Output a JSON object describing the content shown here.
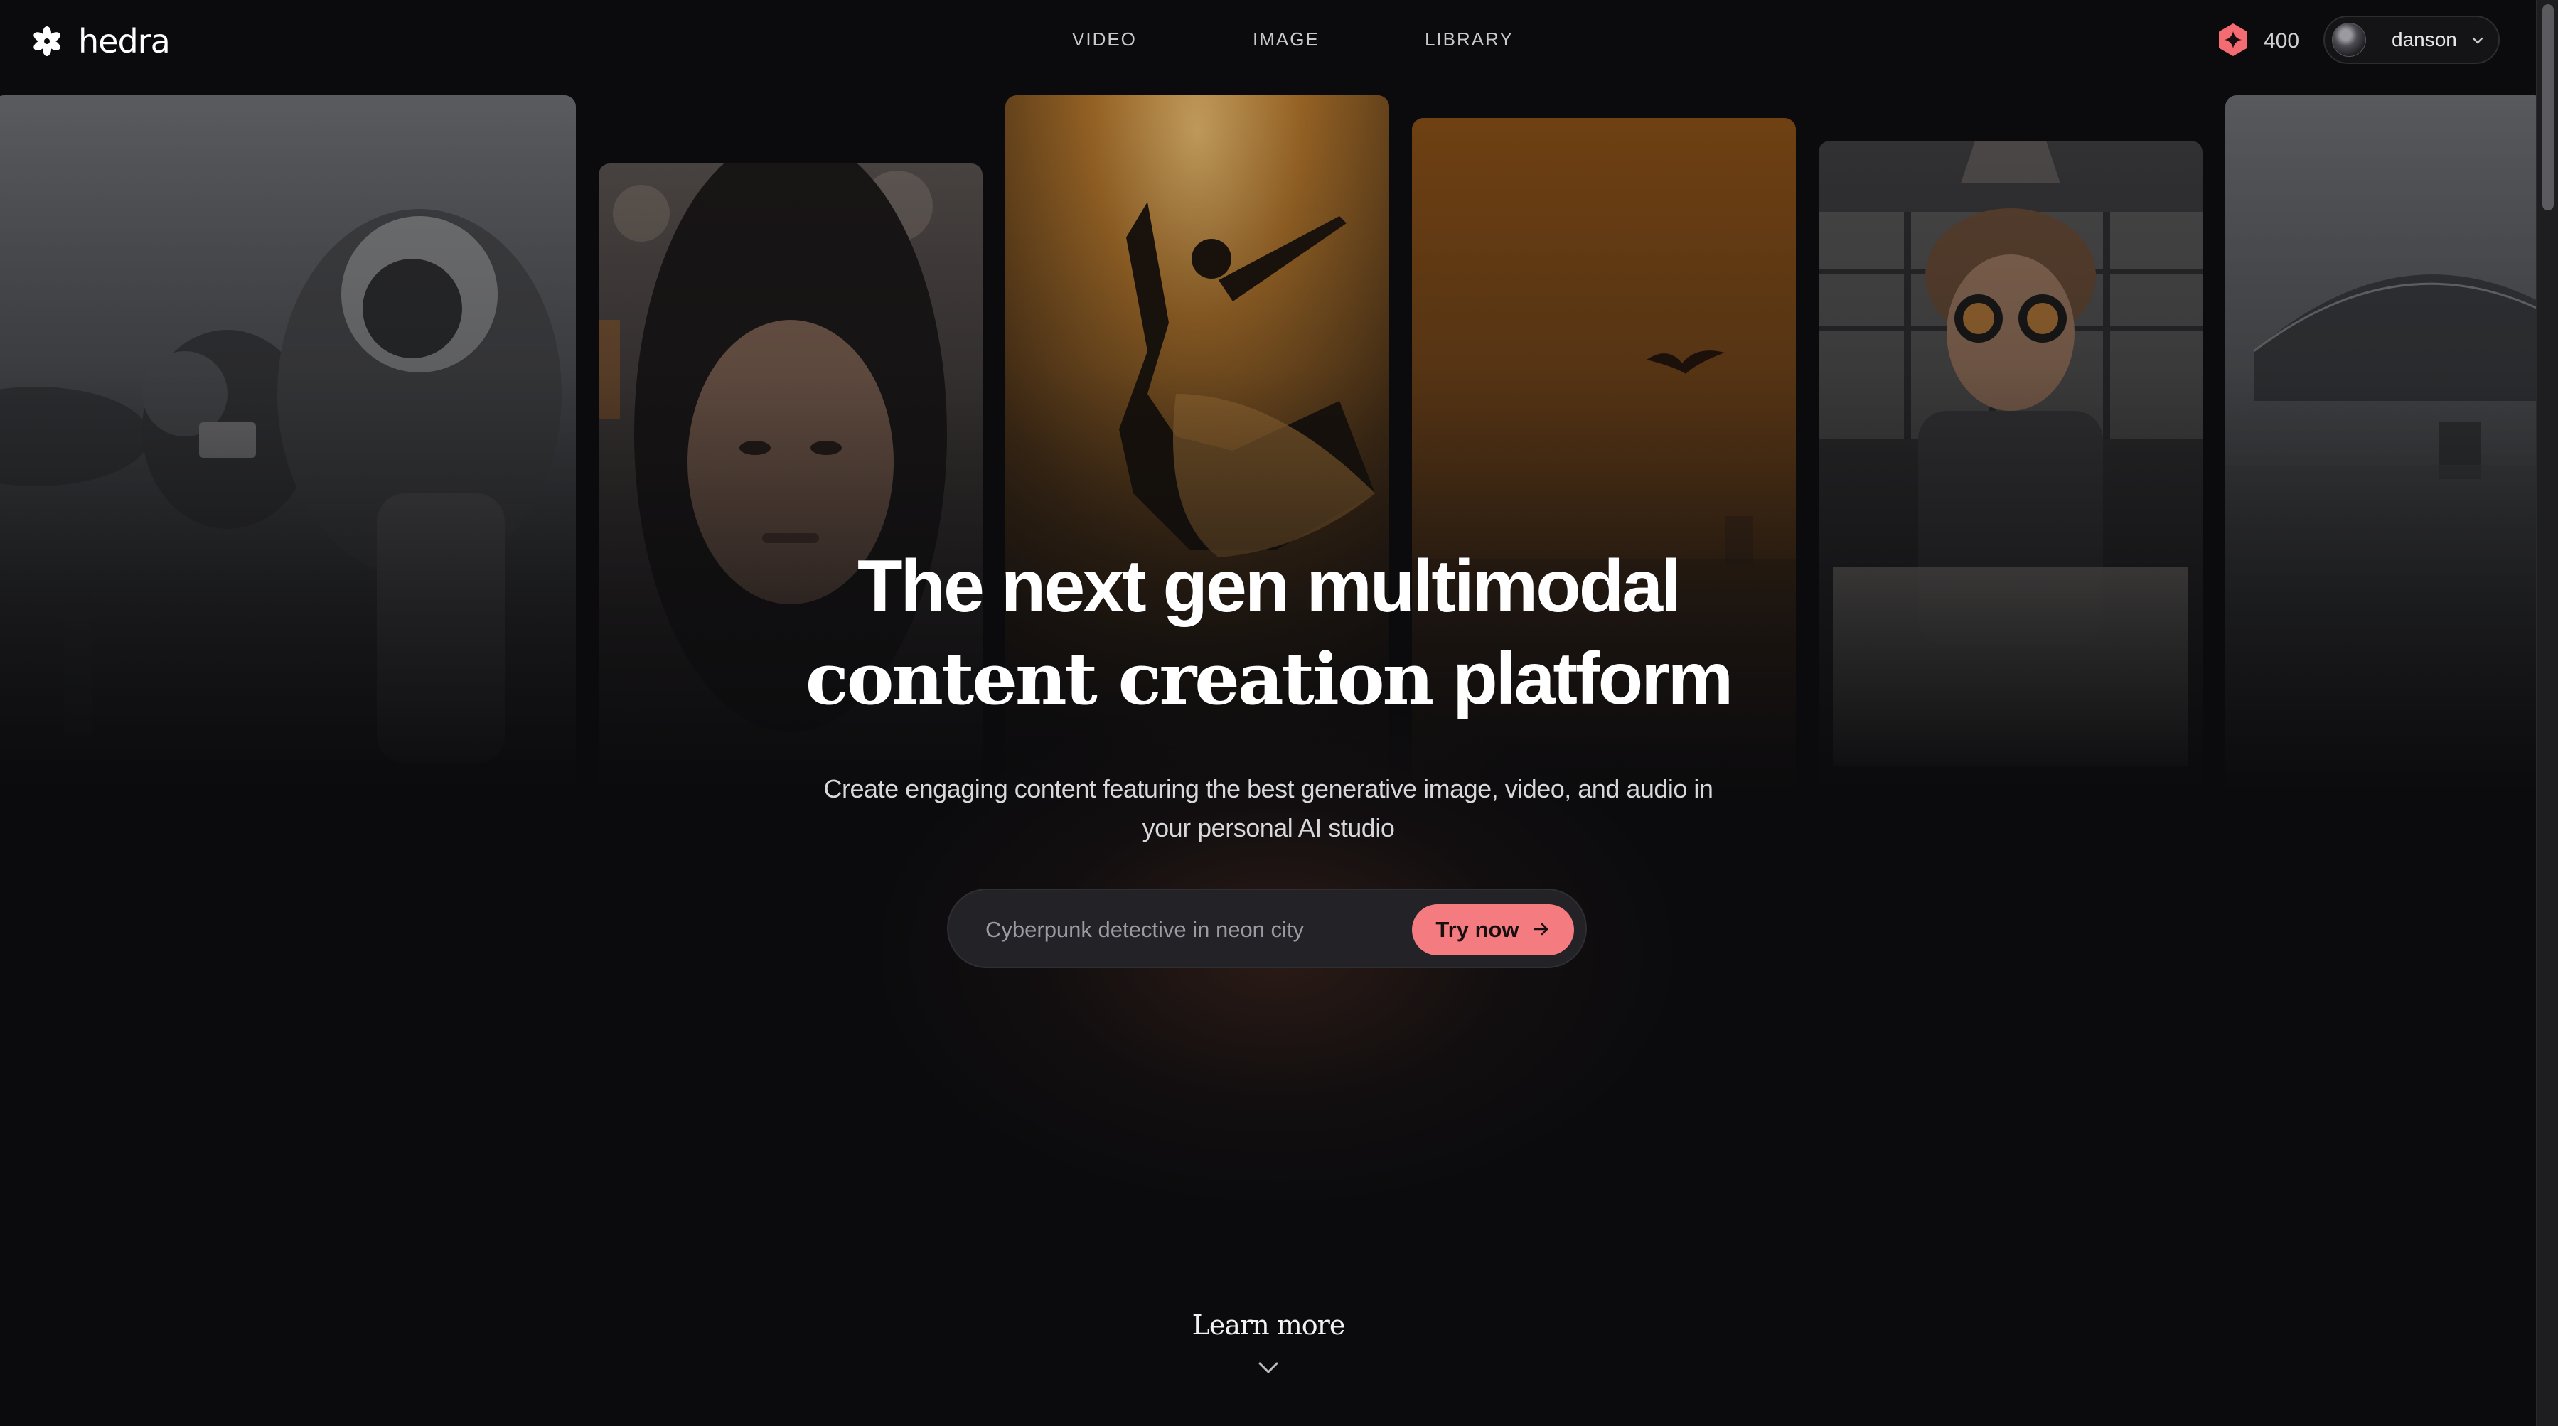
{
  "app": {
    "brand_name": "hedra",
    "logo_icon": "asterisk-flower-icon"
  },
  "nav": {
    "items": [
      {
        "label": "VIDEO"
      },
      {
        "label": "IMAGE"
      },
      {
        "label": "LIBRARY"
      }
    ]
  },
  "account": {
    "credits_icon": "credits-star-icon",
    "credits_count": "400",
    "credits_color": "#f46b72",
    "username": "danson"
  },
  "gallery": {
    "cards": [
      {
        "subject": "astronauts-on-snowy-planet"
      },
      {
        "subject": "woman-portrait"
      },
      {
        "subject": "ballet-dancer-sunset"
      },
      {
        "subject": "bird-over-orange-sky"
      },
      {
        "subject": "boy-with-goggles"
      },
      {
        "subject": "domed-station-snowscape"
      }
    ]
  },
  "hero": {
    "headline_line1": "The next gen multimodal",
    "headline_serif": "content creation",
    "headline_sans": "platform",
    "subtitle": "Create engaging content featuring the best generative image, video, and audio in your personal AI studio"
  },
  "prompt": {
    "placeholder": "Cyberpunk detective in neon city",
    "value": "",
    "button_label": "Try now",
    "button_color": "#f47c80"
  },
  "footer_cta": {
    "label": "Learn more"
  }
}
